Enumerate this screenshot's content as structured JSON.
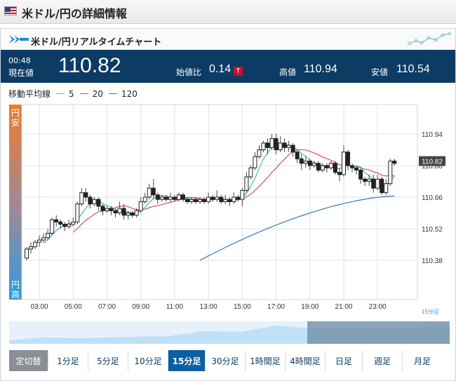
{
  "header": {
    "title": "米ドル/円の詳細情報"
  },
  "panel": {
    "title": "米ドル/円リアルタイムチャート"
  },
  "stats": {
    "time": "00:48",
    "current_label": "現在値",
    "current_value": "110.82",
    "change_label": "始値比",
    "change_value": "0.14",
    "change_direction": "up",
    "high_label": "高値",
    "high_value": "110.94",
    "low_label": "安値",
    "low_value": "110.54"
  },
  "legend": {
    "label": "移動平均線",
    "items": [
      {
        "name": "5",
        "color": "#46b4c8"
      },
      {
        "name": "20",
        "color": "#d9534f"
      },
      {
        "name": "120",
        "color": "#3a78b8"
      }
    ]
  },
  "side": {
    "top": "円安",
    "bottom": "円高"
  },
  "colors": {
    "navy": "#0c3b63",
    "accent_red": "#c8102e",
    "active_blue": "#0c5fa3"
  },
  "timeframes": [
    {
      "label": "定切替",
      "state": "fixed"
    },
    {
      "label": "1分足",
      "state": "normal"
    },
    {
      "label": "5分足",
      "state": "normal"
    },
    {
      "label": "10分足",
      "state": "normal"
    },
    {
      "label": "15分足",
      "state": "active"
    },
    {
      "label": "30分足",
      "state": "normal"
    },
    {
      "label": "1時間足",
      "state": "normal"
    },
    {
      "label": "4時間足",
      "state": "normal"
    },
    {
      "label": "日足",
      "state": "normal"
    },
    {
      "label": "週足",
      "state": "normal"
    },
    {
      "label": "月足",
      "state": "normal"
    }
  ],
  "chart_data": {
    "type": "candlestick",
    "interval_label": "15分足",
    "current_price_tag": "110.82",
    "y_ticks": [
      "110.94",
      "110.80",
      "110.66",
      "110.52",
      "110.38"
    ],
    "ylim": [
      110.38,
      110.94
    ],
    "x_ticks": [
      "03:00",
      "05:00",
      "07:00",
      "09:00",
      "11:00",
      "13:00",
      "15:00",
      "17:00",
      "19:00",
      "21:00",
      "23:00"
    ],
    "xlim": [
      2.25,
      24.9
    ],
    "candles": [
      [
        2.25,
        110.39,
        110.43,
        110.38,
        110.44
      ],
      [
        2.5,
        110.43,
        110.44,
        110.41,
        110.46
      ],
      [
        2.75,
        110.44,
        110.46,
        110.43,
        110.47
      ],
      [
        3.0,
        110.46,
        110.47,
        110.44,
        110.49
      ],
      [
        3.25,
        110.47,
        110.48,
        110.46,
        110.5
      ],
      [
        3.5,
        110.48,
        110.5,
        110.47,
        110.52
      ],
      [
        3.75,
        110.5,
        110.56,
        110.49,
        110.57
      ],
      [
        4.0,
        110.56,
        110.55,
        110.53,
        110.58
      ],
      [
        4.25,
        110.55,
        110.54,
        110.52,
        110.56
      ],
      [
        4.5,
        110.54,
        110.53,
        110.51,
        110.55
      ],
      [
        4.75,
        110.53,
        110.54,
        110.52,
        110.56
      ],
      [
        5.0,
        110.54,
        110.55,
        110.53,
        110.57
      ],
      [
        5.25,
        110.55,
        110.63,
        110.54,
        110.64
      ],
      [
        5.5,
        110.63,
        110.68,
        110.62,
        110.7
      ],
      [
        5.75,
        110.68,
        110.66,
        110.64,
        110.7
      ],
      [
        6.0,
        110.66,
        110.63,
        110.61,
        110.67
      ],
      [
        6.25,
        110.63,
        110.65,
        110.62,
        110.66
      ],
      [
        6.5,
        110.65,
        110.62,
        110.6,
        110.66
      ],
      [
        6.75,
        110.62,
        110.6,
        110.58,
        110.63
      ],
      [
        7.0,
        110.6,
        110.61,
        110.59,
        110.62
      ],
      [
        7.25,
        110.61,
        110.6,
        110.58,
        110.62
      ],
      [
        7.5,
        110.6,
        110.59,
        110.57,
        110.61
      ],
      [
        7.75,
        110.59,
        110.61,
        110.58,
        110.64
      ],
      [
        8.0,
        110.61,
        110.58,
        110.56,
        110.63
      ],
      [
        8.25,
        110.58,
        110.59,
        110.56,
        110.6
      ],
      [
        8.5,
        110.59,
        110.58,
        110.57,
        110.6
      ],
      [
        8.75,
        110.58,
        110.6,
        110.57,
        110.61
      ],
      [
        9.0,
        110.6,
        110.64,
        110.59,
        110.66
      ],
      [
        9.25,
        110.64,
        110.66,
        110.63,
        110.68
      ],
      [
        9.5,
        110.66,
        110.7,
        110.65,
        110.72
      ],
      [
        9.75,
        110.7,
        110.67,
        110.65,
        110.74
      ],
      [
        10.0,
        110.67,
        110.65,
        110.63,
        110.68
      ],
      [
        10.25,
        110.65,
        110.66,
        110.64,
        110.67
      ],
      [
        10.5,
        110.66,
        110.65,
        110.64,
        110.67
      ],
      [
        10.75,
        110.65,
        110.66,
        110.64,
        110.68
      ],
      [
        11.0,
        110.66,
        110.65,
        110.64,
        110.67
      ],
      [
        11.25,
        110.65,
        110.67,
        110.64,
        110.68
      ],
      [
        11.5,
        110.67,
        110.65,
        110.64,
        110.68
      ],
      [
        11.75,
        110.65,
        110.64,
        110.63,
        110.66
      ],
      [
        12.0,
        110.64,
        110.65,
        110.63,
        110.66
      ],
      [
        12.25,
        110.65,
        110.64,
        110.63,
        110.66
      ],
      [
        12.5,
        110.64,
        110.65,
        110.63,
        110.66
      ],
      [
        12.75,
        110.65,
        110.64,
        110.63,
        110.66
      ],
      [
        13.0,
        110.64,
        110.66,
        110.63,
        110.68
      ],
      [
        13.25,
        110.66,
        110.65,
        110.64,
        110.67
      ],
      [
        13.5,
        110.65,
        110.66,
        110.64,
        110.69
      ],
      [
        13.75,
        110.66,
        110.64,
        110.63,
        110.67
      ],
      [
        14.0,
        110.64,
        110.65,
        110.63,
        110.67
      ],
      [
        14.25,
        110.65,
        110.64,
        110.62,
        110.66
      ],
      [
        14.5,
        110.64,
        110.66,
        110.63,
        110.68
      ],
      [
        14.75,
        110.66,
        110.65,
        110.64,
        110.67
      ],
      [
        15.0,
        110.65,
        110.69,
        110.62,
        110.7
      ],
      [
        15.25,
        110.69,
        110.75,
        110.68,
        110.77
      ],
      [
        15.5,
        110.75,
        110.79,
        110.74,
        110.8
      ],
      [
        15.75,
        110.79,
        110.84,
        110.78,
        110.86
      ],
      [
        16.0,
        110.84,
        110.87,
        110.83,
        110.89
      ],
      [
        16.25,
        110.87,
        110.9,
        110.86,
        110.91
      ],
      [
        16.5,
        110.9,
        110.88,
        110.85,
        110.92
      ],
      [
        16.75,
        110.88,
        110.92,
        110.87,
        110.94
      ],
      [
        17.0,
        110.92,
        110.87,
        110.85,
        110.94
      ],
      [
        17.25,
        110.87,
        110.9,
        110.86,
        110.93
      ],
      [
        17.5,
        110.9,
        110.88,
        110.86,
        110.92
      ],
      [
        17.75,
        110.88,
        110.89,
        110.86,
        110.91
      ],
      [
        18.0,
        110.89,
        110.86,
        110.84,
        110.9
      ],
      [
        18.25,
        110.86,
        110.83,
        110.81,
        110.87
      ],
      [
        18.5,
        110.83,
        110.81,
        110.78,
        110.85
      ],
      [
        18.75,
        110.81,
        110.82,
        110.79,
        110.84
      ],
      [
        19.0,
        110.82,
        110.8,
        110.78,
        110.83
      ],
      [
        19.25,
        110.8,
        110.81,
        110.79,
        110.82
      ],
      [
        19.5,
        110.81,
        110.78,
        110.77,
        110.82
      ],
      [
        19.75,
        110.78,
        110.8,
        110.77,
        110.81
      ],
      [
        20.0,
        110.8,
        110.79,
        110.77,
        110.81
      ],
      [
        20.25,
        110.79,
        110.81,
        110.78,
        110.82
      ],
      [
        20.5,
        110.81,
        110.77,
        110.76,
        110.82
      ],
      [
        20.75,
        110.77,
        110.76,
        110.73,
        110.79
      ],
      [
        21.0,
        110.76,
        110.86,
        110.75,
        110.89
      ],
      [
        21.25,
        110.86,
        110.8,
        110.78,
        110.87
      ],
      [
        21.5,
        110.8,
        110.79,
        110.77,
        110.81
      ],
      [
        21.75,
        110.79,
        110.78,
        110.76,
        110.8
      ],
      [
        22.0,
        110.78,
        110.74,
        110.72,
        110.79
      ],
      [
        22.25,
        110.74,
        110.73,
        110.71,
        110.75
      ],
      [
        22.5,
        110.73,
        110.74,
        110.71,
        110.76
      ],
      [
        22.75,
        110.74,
        110.7,
        110.68,
        110.76
      ],
      [
        23.0,
        110.7,
        110.74,
        110.69,
        110.76
      ],
      [
        23.25,
        110.74,
        110.68,
        110.67,
        110.75
      ],
      [
        23.5,
        110.68,
        110.72,
        110.67,
        110.74
      ],
      [
        23.75,
        110.72,
        110.82,
        110.71,
        110.83
      ],
      [
        24.0,
        110.82,
        110.81,
        110.8,
        110.83
      ]
    ]
  }
}
